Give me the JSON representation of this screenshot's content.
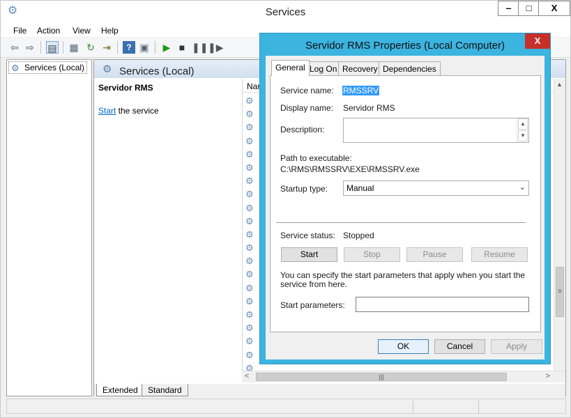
{
  "window": {
    "title": "Services",
    "icon": "gears-icon",
    "buttons": {
      "minimize": "‒",
      "maximize": "□",
      "close": "X"
    }
  },
  "menubar": [
    "File",
    "Action",
    "View",
    "Help"
  ],
  "toolbar": {
    "icons": [
      "back-arrow-icon",
      "forward-arrow-icon",
      "show-hide-console-tree-icon",
      "properties-icon",
      "refresh-icon",
      "export-list-icon",
      "help-icon",
      "mmc-icon",
      "start-service-icon",
      "stop-service-icon",
      "pause-service-icon",
      "restart-service-icon"
    ]
  },
  "tree": {
    "root": "Services (Local)"
  },
  "main": {
    "header": "Services (Local)",
    "selected_service": "Servidor RMS",
    "start_link": "Start",
    "start_suffix": " the service",
    "column_name": "Nar",
    "bottom_tabs": [
      "Extended",
      "Standard"
    ]
  },
  "dialog": {
    "title": "Servidor RMS Properties (Local Computer)",
    "close": "X",
    "tabs": [
      "General",
      "Log On",
      "Recovery",
      "Dependencies"
    ],
    "active_tab": "General",
    "service_name_label": "Service name:",
    "service_name": "RMSSRV",
    "display_name_label": "Display name:",
    "display_name": "Servidor RMS",
    "description_label": "Description:",
    "description": "",
    "path_label": "Path to executable:",
    "path": "C:\\RMS\\RMSSRV\\EXE\\RMSSRV.exe",
    "startup_type_label": "Startup type:",
    "startup_type": "Manual",
    "status_label": "Service status:",
    "status": "Stopped",
    "buttons": {
      "start": "Start",
      "stop": "Stop",
      "pause": "Pause",
      "resume": "Resume"
    },
    "params_hint": "You can specify the start parameters that apply when you start the service from here.",
    "params_label": "Start parameters:",
    "params_value": "",
    "footer": {
      "ok": "OK",
      "cancel": "Cancel",
      "apply": "Apply"
    }
  }
}
